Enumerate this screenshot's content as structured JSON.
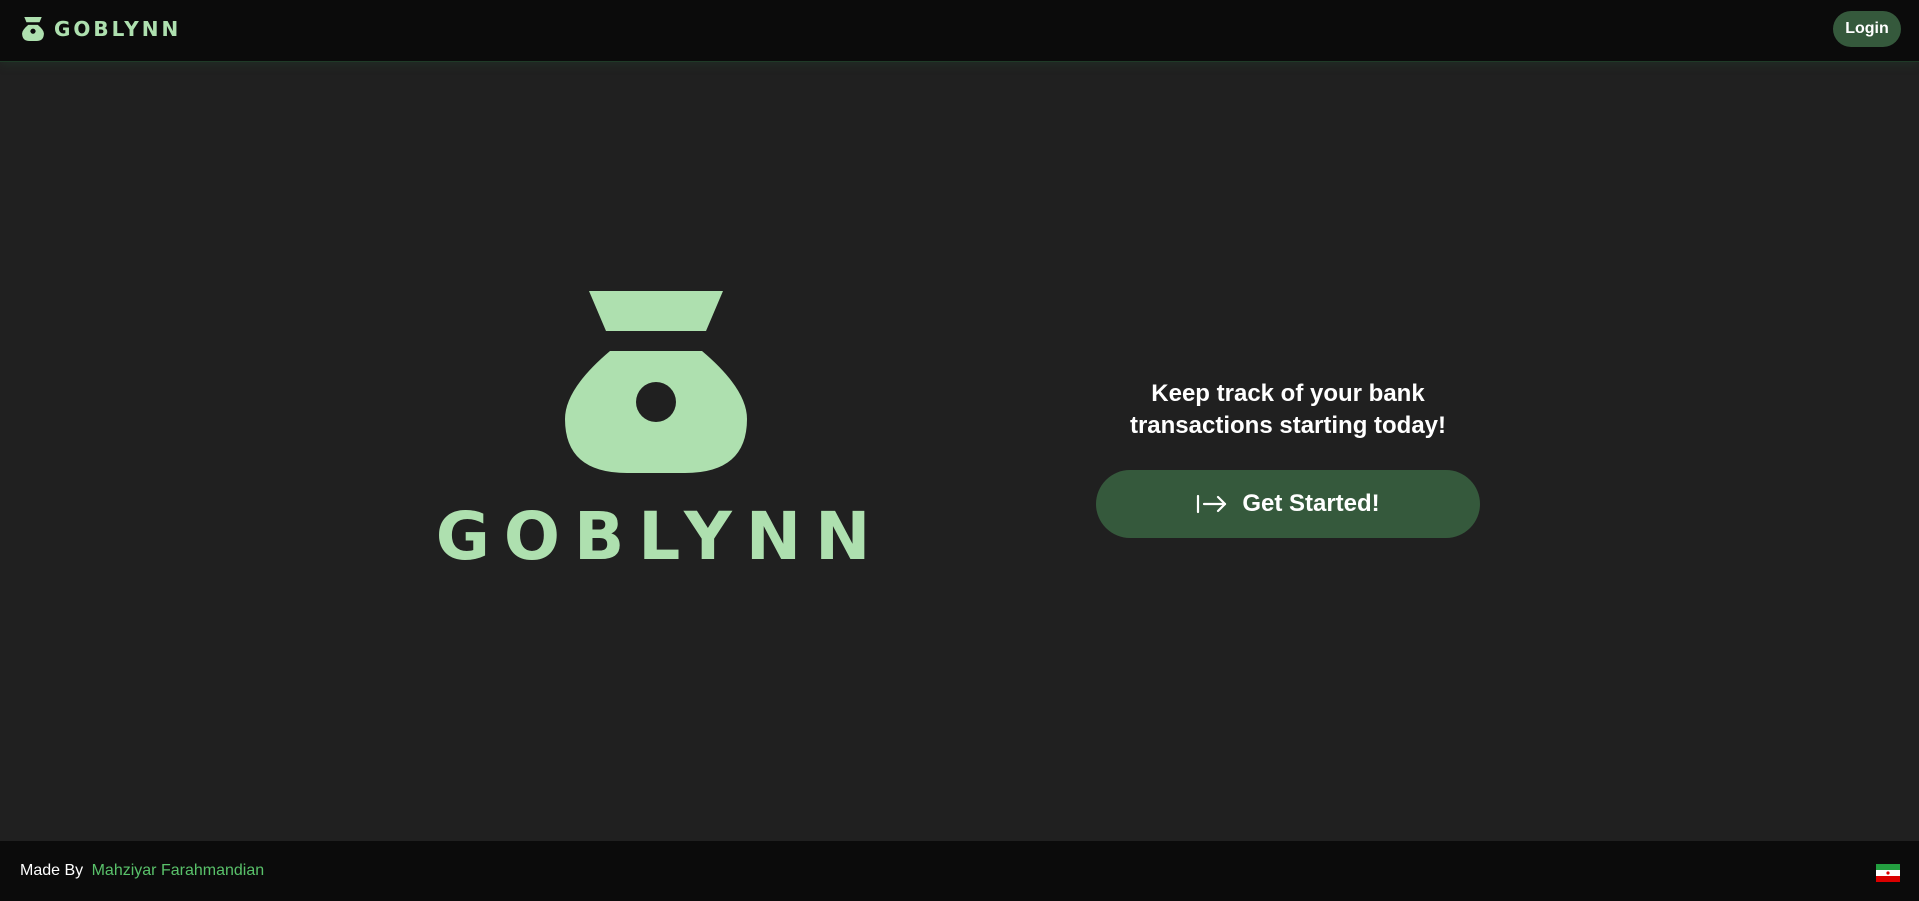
{
  "navbar": {
    "brand_name": "GOBLYNN",
    "brand_icon": "money-bag-icon",
    "login_label": "Login"
  },
  "hero": {
    "logo_icon": "money-bag-icon",
    "logo_word": "GOBLYNN",
    "tagline": "Keep track of your bank transactions starting today!",
    "cta_icon": "arrow-right-to-bar-icon",
    "cta_label": "Get Started!"
  },
  "footer": {
    "made_by_label": "Made By",
    "author_name": "Mahziyar Farahmandian",
    "flag_icon": "iran-flag-icon"
  },
  "colors": {
    "background": "#202020",
    "navbar_bg": "#0b0b0b",
    "brand_green": "#aee0af",
    "button_green": "#35593c",
    "link_green": "#59c16a",
    "text": "#ffffff"
  }
}
